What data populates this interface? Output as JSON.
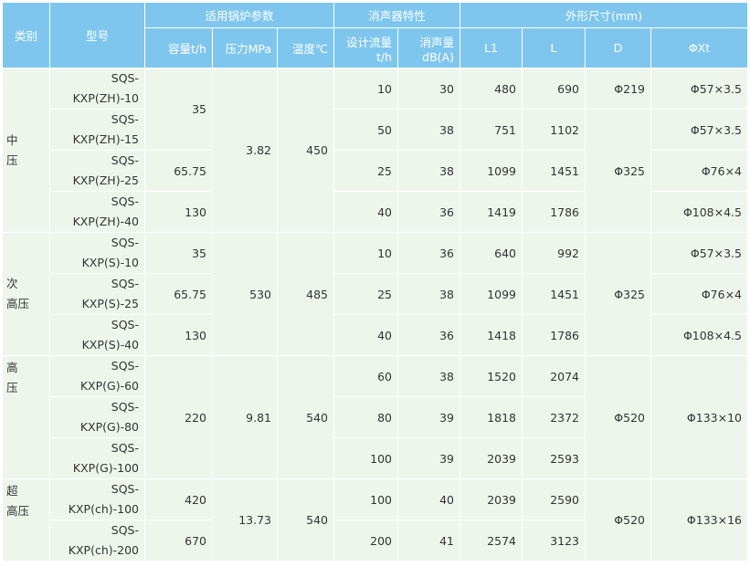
{
  "header": {
    "category": "类别",
    "model": "型号",
    "boiler_group": "适用锅炉参数",
    "silencer_group": "消声器特性",
    "dims_group": "外形尺寸(mm)",
    "capacity": "容量t/h",
    "pressure": "压力MPa",
    "temperature": "温度℃",
    "design_flow": "设计流量t/h",
    "noise": "消声量dB(A)",
    "L1": "L1",
    "L": "L",
    "D": "D",
    "PhiXt": "ΦXt"
  },
  "categories": [
    {
      "line1": "中",
      "line2": "压"
    },
    {
      "line1": "次",
      "line2": "高压"
    },
    {
      "line1": "高",
      "line2": "压"
    },
    {
      "line1": "超",
      "line2": "高压"
    }
  ],
  "rows": [
    {
      "model_a": "SQS-",
      "model_b": "KXP(ZH)-10",
      "flow": "10",
      "noise": "30",
      "L1": "480",
      "L": "690",
      "phixt": "Φ57×3.5"
    },
    {
      "model_a": "SQS-",
      "model_b": "KXP(ZH)-15",
      "flow": "50",
      "noise": "38",
      "L1": "751",
      "L": "1102",
      "phixt": "Φ57×3.5"
    },
    {
      "model_a": "SQS-",
      "model_b": "KXP(ZH)-25",
      "flow": "25",
      "noise": "38",
      "L1": "1099",
      "L": "1451",
      "phixt": "Φ76×4"
    },
    {
      "model_a": "SQS-",
      "model_b": "KXP(ZH)-40",
      "flow": "40",
      "noise": "36",
      "L1": "1419",
      "L": "1786",
      "phixt": "Φ108×4.5"
    },
    {
      "model_a": "SQS-",
      "model_b": "KXP(S)-10",
      "flow": "10",
      "noise": "36",
      "L1": "640",
      "L": "992",
      "phixt": "Φ57×3.5"
    },
    {
      "model_a": "SQS-",
      "model_b": "KXP(S)-25",
      "flow": "25",
      "noise": "38",
      "L1": "1099",
      "L": "1451",
      "phixt": "Φ76×4"
    },
    {
      "model_a": "SQS-",
      "model_b": "KXP(S)-40",
      "flow": "40",
      "noise": "36",
      "L1": "1418",
      "L": "1786",
      "phixt": "Φ108×4.5"
    },
    {
      "model_a": "SQS-",
      "model_b": "KXP(G)-60",
      "flow": "60",
      "noise": "38",
      "L1": "1520",
      "L": "2074"
    },
    {
      "model_a": "SQS-",
      "model_b": "KXP(G)-80",
      "flow": "80",
      "noise": "39",
      "L1": "1818",
      "L": "2372"
    },
    {
      "model_a": "SQS-",
      "model_b": "KXP(G)-100",
      "flow": "100",
      "noise": "39",
      "L1": "2039",
      "L": "2593"
    },
    {
      "model_a": "SQS-",
      "model_b": "KXP(ch)-100",
      "flow": "100",
      "noise": "40",
      "L1": "2039",
      "L": "2590"
    },
    {
      "model_a": "SQS-",
      "model_b": "KXP(ch)-200",
      "flow": "200",
      "noise": "41",
      "L1": "2574",
      "L": "3123"
    }
  ],
  "merged": {
    "capacity": [
      "35",
      "65.75",
      "130",
      "35",
      "65.75",
      "130",
      "220",
      "420",
      "670"
    ],
    "pressure": [
      "3.82",
      "530",
      "9.81",
      "13.73"
    ],
    "temperature": [
      "450",
      "485",
      "540",
      "540"
    ],
    "D": [
      "Φ219",
      "Φ325",
      "Φ325",
      "Φ520",
      "Φ520"
    ],
    "phixt": [
      "Φ133×10",
      "Φ133×16"
    ]
  }
}
